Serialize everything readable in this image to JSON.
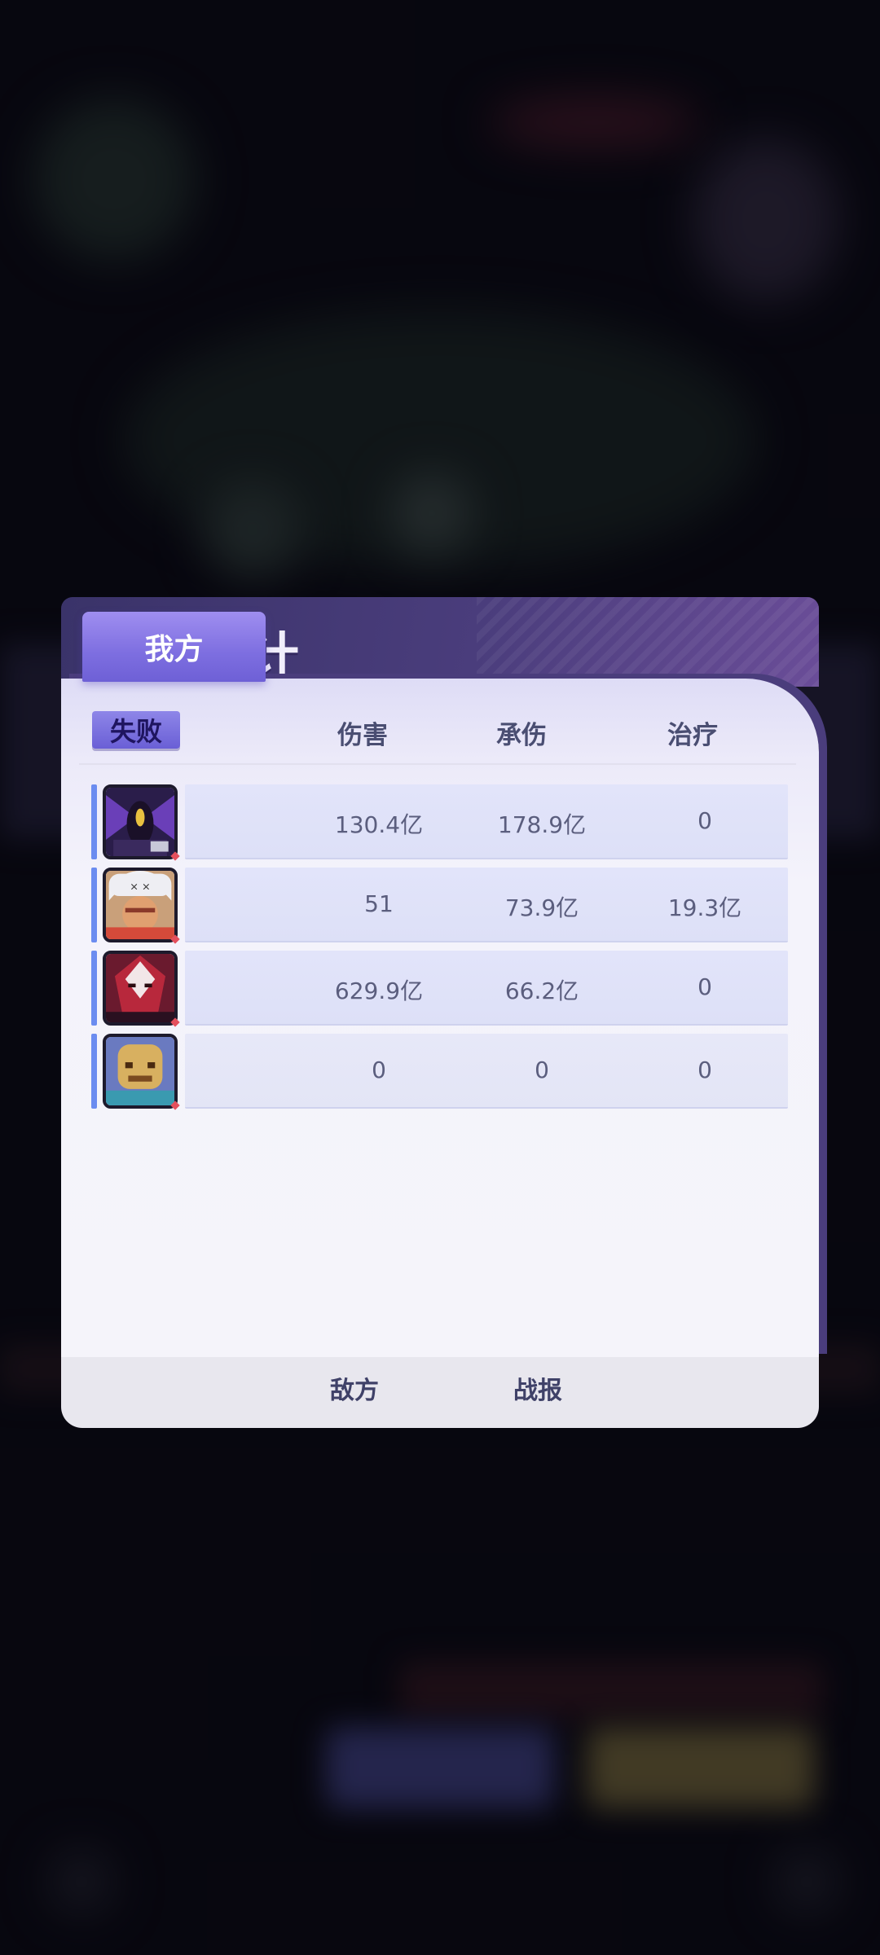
{
  "dialog": {
    "title": "战斗统计",
    "result_badge": "失败",
    "columns": {
      "damage": "伤害",
      "taken": "承伤",
      "heal": "治疗"
    }
  },
  "heroes": [
    {
      "icon": "dark-winged-hero-portrait",
      "damage": "130.4亿",
      "taken": "178.9亿",
      "heal": "0"
    },
    {
      "icon": "white-bear-hood-hero-portrait",
      "damage": "51",
      "taken": "73.9亿",
      "heal": "19.3亿"
    },
    {
      "icon": "red-mask-hero-portrait",
      "damage": "629.9亿",
      "taken": "66.2亿",
      "heal": "0"
    },
    {
      "icon": "golden-mask-hero-portrait",
      "damage": "0",
      "taken": "0",
      "heal": "0"
    }
  ],
  "tabs": {
    "mine": "我方",
    "enemy": "敌方",
    "report": "战报"
  },
  "colors": {
    "accent": "#6b8cf0",
    "header": "#4a3d7c",
    "active_tab": "#7d6ee0",
    "badge": "#7a70dc"
  }
}
